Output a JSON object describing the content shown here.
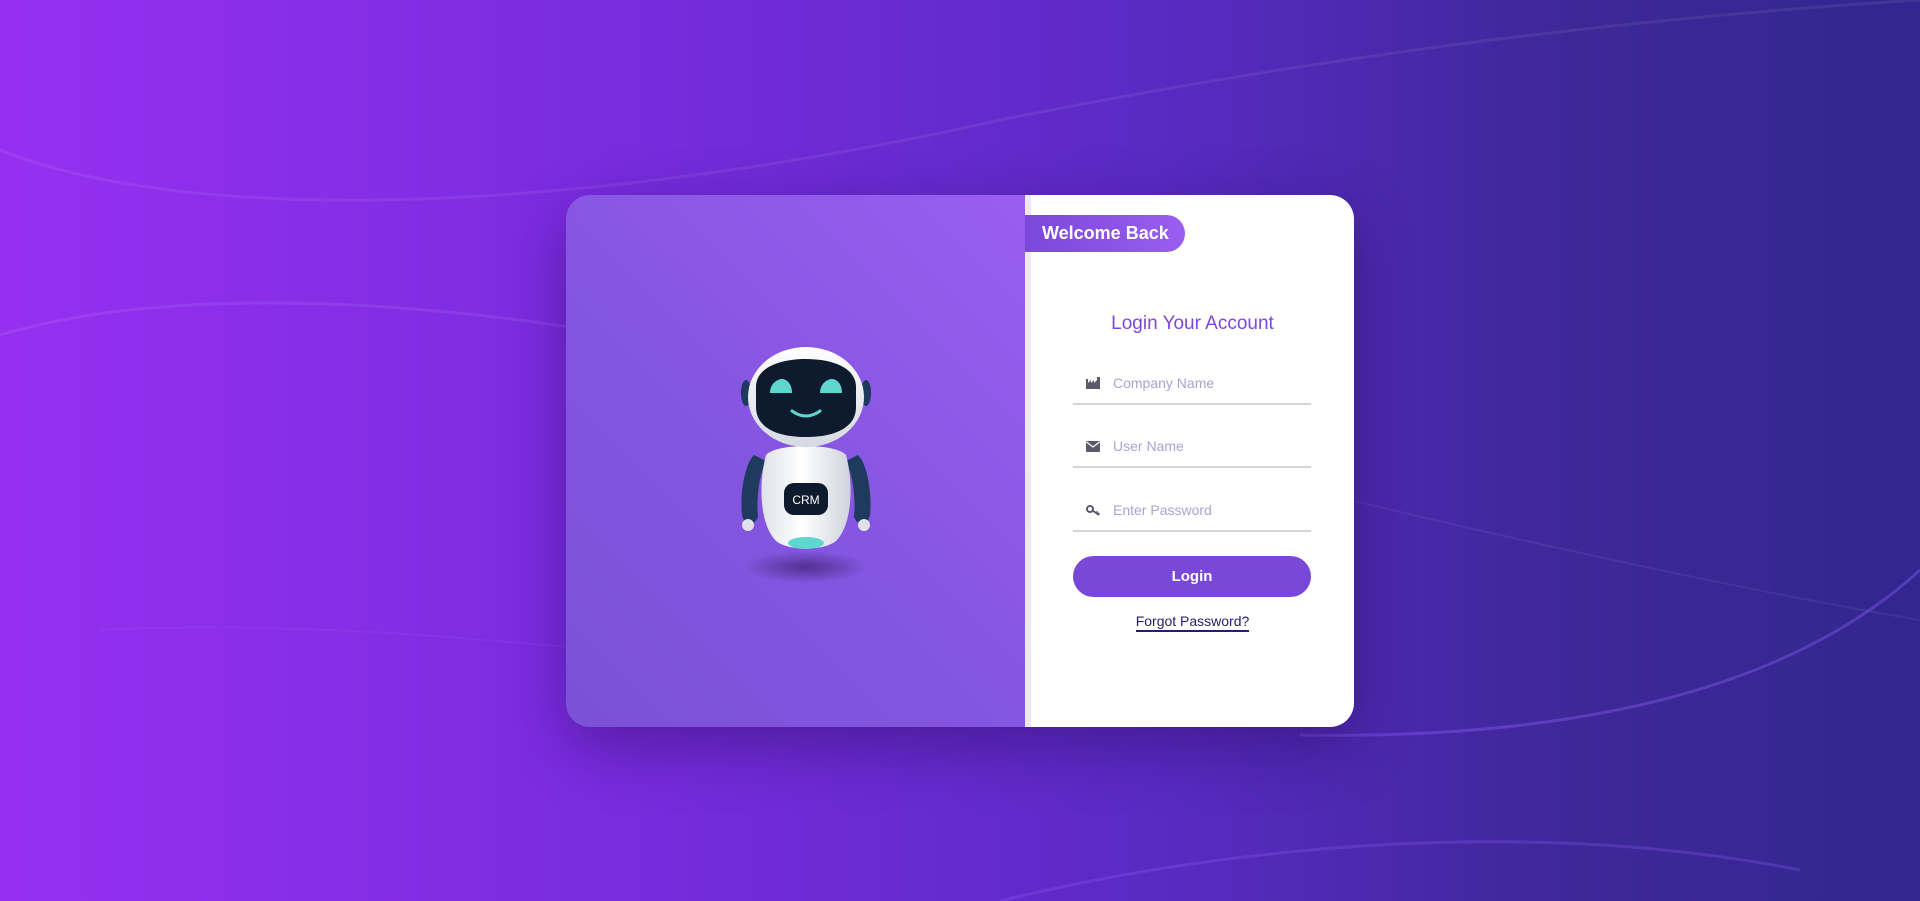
{
  "colors": {
    "accent": "#7a48d9",
    "background_start": "#9630f1",
    "background_end": "#332690",
    "placeholder": "#a8a3cf"
  },
  "brand": {
    "robot_badge": "CRM"
  },
  "login_card": {
    "welcome_badge": "Welcome Back",
    "title": "Login Your Account",
    "company_field": {
      "icon": "factory-icon",
      "placeholder": "Company Name",
      "value": ""
    },
    "username_field": {
      "icon": "envelope-icon",
      "placeholder": "User Name",
      "value": ""
    },
    "password_field": {
      "icon": "key-icon",
      "placeholder": "Enter Password",
      "value": ""
    },
    "login_button": "Login",
    "forgot_link": "Forgot Password?"
  }
}
